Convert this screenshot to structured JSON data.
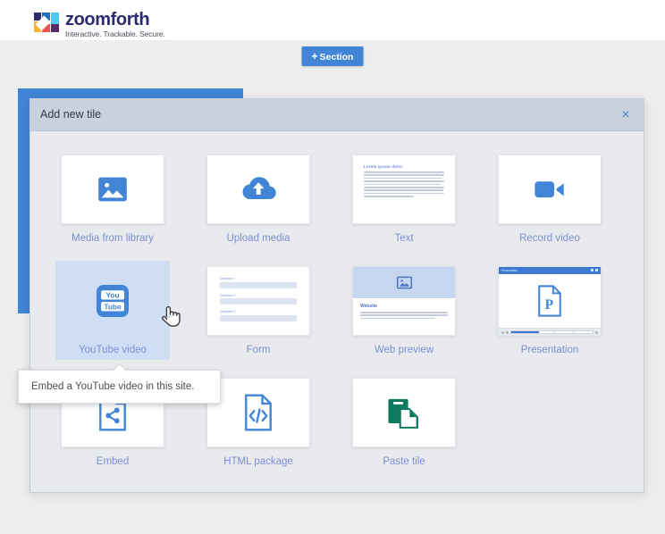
{
  "brand": {
    "name": "zoomforth",
    "tagline": "Interactive. Trackable. Secure.",
    "logo_icon": "zoomforth-squares-logo",
    "colors": {
      "navy": "#2d2a6e",
      "blue": "#1f6fc4",
      "light_blue": "#52c8f0",
      "yellow": "#f9b233",
      "red": "#ef5350",
      "purple": "#5b2a6e"
    }
  },
  "page": {
    "section_button": {
      "plus": "+",
      "label": "Section"
    },
    "accent_color": "#4285d6"
  },
  "modal": {
    "title": "Add new tile",
    "close_icon": "close-icon",
    "close_label": "×",
    "tiles": [
      {
        "id": "media-from-library",
        "label": "Media from library",
        "icon": "image-icon",
        "selected": false
      },
      {
        "id": "upload-media",
        "label": "Upload media",
        "icon": "cloud-upload-icon",
        "selected": false
      },
      {
        "id": "text",
        "label": "Text",
        "icon": "text-document-preview",
        "selected": false
      },
      {
        "id": "record-video",
        "label": "Record video",
        "icon": "video-camera-icon",
        "selected": false
      },
      {
        "id": "youtube-video",
        "label": "YouTube video",
        "icon": "youtube-icon",
        "selected": true
      },
      {
        "id": "form",
        "label": "Form",
        "icon": "form-preview",
        "selected": false
      },
      {
        "id": "web-preview",
        "label": "Web preview",
        "icon": "web-preview-card",
        "selected": false
      },
      {
        "id": "presentation",
        "label": "Presentation",
        "icon": "presentation-window-icon",
        "selected": false
      },
      {
        "id": "embed",
        "label": "Embed",
        "icon": "embed-share-icon",
        "selected": false
      },
      {
        "id": "html-package",
        "label": "HTML package",
        "icon": "html-code-icon",
        "selected": false
      },
      {
        "id": "paste-tile",
        "label": "Paste tile",
        "icon": "paste-clipboard-icon",
        "selected": false
      }
    ]
  },
  "text_tile_preview": {
    "heading": "Lorem ipsum dolor",
    "body_line_count": 9
  },
  "form_tile_preview": {
    "questions": [
      "Question 1",
      "Question 2",
      "Question 3"
    ]
  },
  "web_preview_tile": {
    "heading": "Website",
    "body_line_count": 3,
    "hero_icon": "image-icon"
  },
  "presentation_tile": {
    "window_title": "Presentation",
    "page_glyph": "P"
  },
  "tooltip": {
    "text": "Embed a YouTube video in this site."
  },
  "cursor": {
    "icon": "pointing-hand-cursor"
  }
}
